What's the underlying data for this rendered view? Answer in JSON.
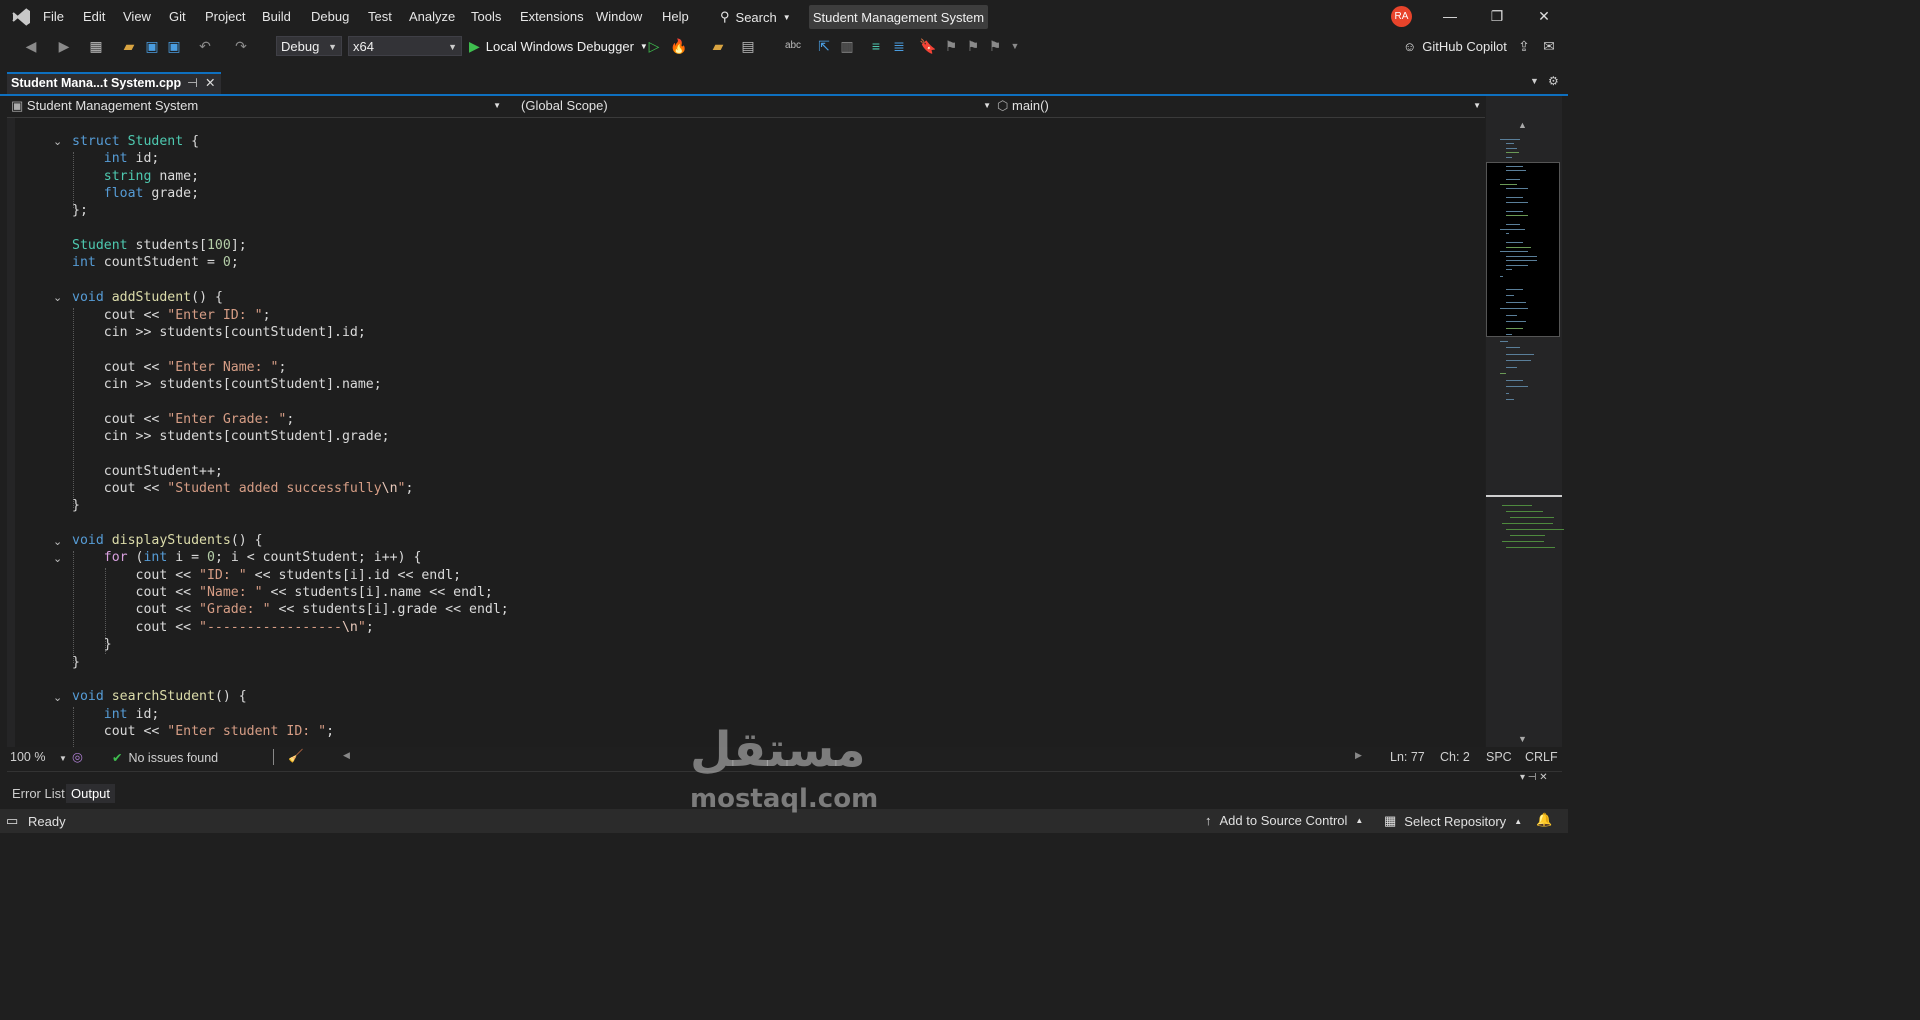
{
  "menu": [
    "File",
    "Edit",
    "View",
    "Git",
    "Project",
    "Build",
    "Debug",
    "Test",
    "Analyze",
    "Tools",
    "Extensions",
    "Window",
    "Help"
  ],
  "search_label": "Search",
  "solution_title": "Student Management System",
  "avatar_initials": "RA",
  "toolbar": {
    "config": "Debug",
    "platform": "x64",
    "debugger": "Local Windows Debugger",
    "copilot": "GitHub Copilot"
  },
  "tab": {
    "title": "Student Mana...t System.cpp"
  },
  "nav": {
    "project": "Student Management System",
    "scope": "(Global Scope)",
    "member": "main()"
  },
  "code_lines": [
    "struct Student {",
    "    int id;",
    "    string name;",
    "    float grade;",
    "};",
    "",
    "Student students[100];",
    "int countStudent = 0;",
    "",
    "void addStudent() {",
    "    cout << \"Enter ID: \";",
    "    cin >> students[countStudent].id;",
    "",
    "    cout << \"Enter Name: \";",
    "    cin >> students[countStudent].name;",
    "",
    "    cout << \"Enter Grade: \";",
    "    cin >> students[countStudent].grade;",
    "",
    "    countStudent++;",
    "    cout << \"Student added successfully\\n\";",
    "}",
    "",
    "void displayStudents() {",
    "    for (int i = 0; i < countStudent; i++) {",
    "        cout << \"ID: \" << students[i].id << endl;",
    "        cout << \"Name: \" << students[i].name << endl;",
    "        cout << \"Grade: \" << students[i].grade << endl;",
    "        cout << \"-----------------\\n\";",
    "    }",
    "}",
    "",
    "void searchStudent() {",
    "    int id;",
    "    cout << \"Enter student ID: \";"
  ],
  "editor_status": {
    "zoom": "100 %",
    "issues": "No issues found",
    "line": "Ln: 77",
    "col": "Ch: 2",
    "spc": "SPC",
    "eol": "CRLF"
  },
  "panel_tabs": [
    "Error List",
    "Output"
  ],
  "status": {
    "ready": "Ready",
    "source_control": "Add to Source Control",
    "repository": "Select Repository"
  },
  "watermark": {
    "arabic": "مستقل",
    "latin": "mostaql.com"
  },
  "colors": {
    "accent": "#0e70c0",
    "keyword": "#569cd6",
    "type": "#4ec9b0",
    "string": "#d69d85",
    "number": "#b5cea8",
    "function": "#dcdcaa"
  }
}
